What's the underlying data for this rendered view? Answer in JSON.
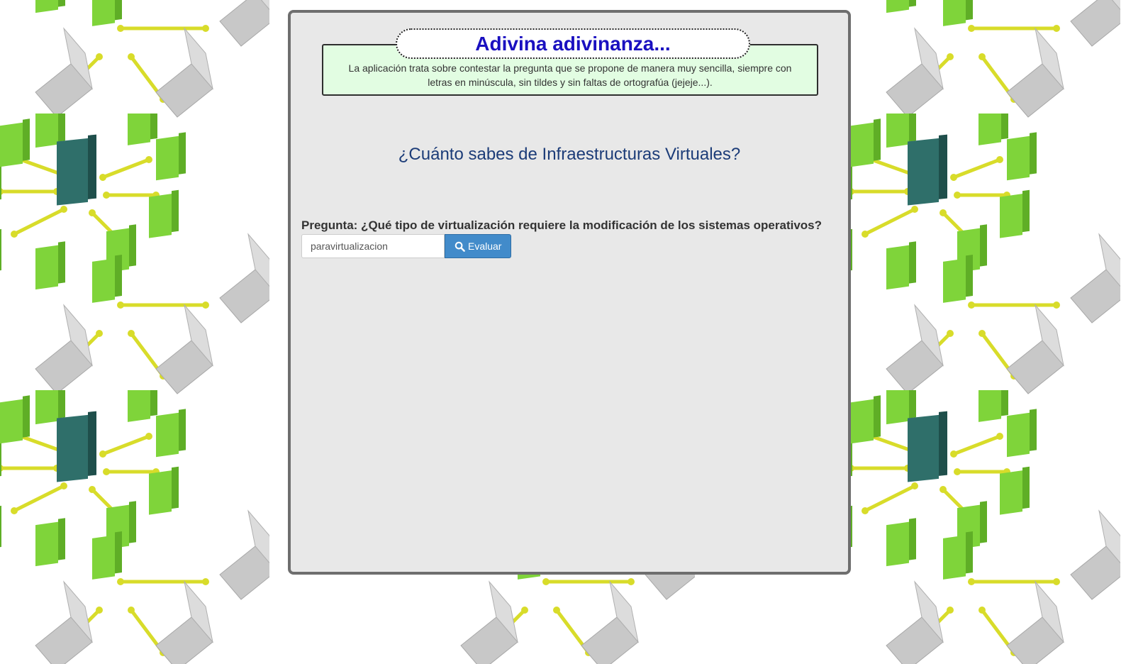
{
  "header": {
    "title": "Adivina adivinanza...",
    "description": "La aplicación trata sobre contestar la pregunta que se propone de manera muy sencilla, siempre con letras en minúscula, sin tildes y sin faltas de ortografúa (jejeje...)."
  },
  "quiz": {
    "subject": "¿Cuánto sabes de Infraestructuras Virtuales?",
    "question": "Pregunta: ¿Qué tipo de virtualización requiere la modificación de los sistemas operativos?",
    "answer_value": "paravirtualizacion",
    "submit_label": "Evaluar",
    "submit_icon": "search-icon"
  },
  "background": {
    "pattern": "network-server-laptops",
    "colors": {
      "server_green": "#7fd43a",
      "server_teal": "#2f6f6a",
      "laptop_gray": "#c8c8c8",
      "arrow_yellow": "#d8dc2a"
    }
  },
  "colors": {
    "panel_background": "#e8e8e8",
    "panel_border": "#6e6e6e",
    "intro_background": "#e2fde2",
    "title_color": "#1a10c0",
    "subject_color": "#1c3c78",
    "button_color": "#428bca"
  }
}
